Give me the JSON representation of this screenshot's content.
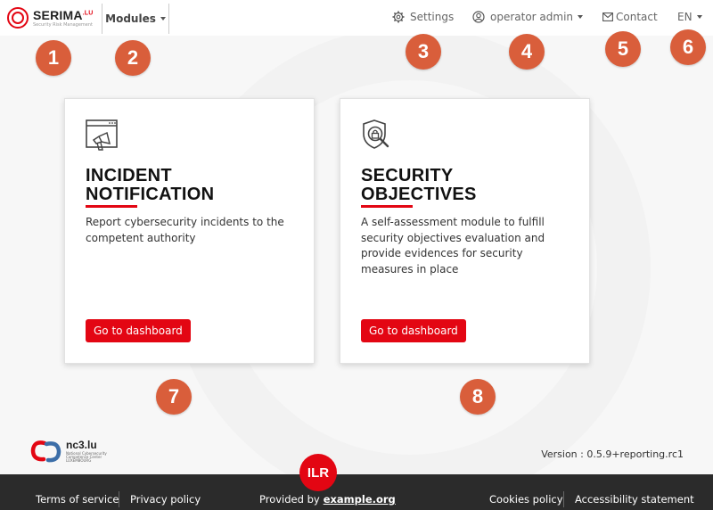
{
  "header": {
    "logo_name": "SERIMA",
    "logo_tld": ".LU",
    "logo_subtitle": "Security Risk Management",
    "modules_label": "Modules",
    "settings_label": "Settings",
    "user_label": "operator admin",
    "contact_label": "Contact",
    "language_label": "EN"
  },
  "badges": [
    "1",
    "2",
    "3",
    "4",
    "5",
    "6",
    "7",
    "8"
  ],
  "cards": [
    {
      "title_line1": "INCIDENT",
      "title_line2": "NOTIFICATION",
      "description": "Report cybersecurity incidents to the competent authority",
      "button_label": "Go to dashboard",
      "icon": "megaphone-window-icon"
    },
    {
      "title_line1": "SECURITY",
      "title_line2": "OBJECTIVES",
      "description": "A self-assessment module to fulfill security objectives evaluation and provide evidences for security measures in place",
      "button_label": "Go to dashboard",
      "icon": "shield-lock-search-icon"
    }
  ],
  "footer": {
    "nc3_name": "nc3.lu",
    "nc3_subtitle": "National Cybersecurity Competence Center LUXEMBOURG",
    "version": "Version : 0.5.9+reporting.rc1",
    "terms_label": "Terms of service",
    "privacy_label": "Privacy policy",
    "provided_prefix": "Provided by",
    "provided_link": "example.org",
    "ilr_label": "ILR",
    "cookies_label": "Cookies policy",
    "accessibility_label": "Accessibility statement"
  },
  "colors": {
    "accent": "#e30613",
    "badge": "#d95e3b",
    "footer_bg": "#2b2b2b"
  }
}
